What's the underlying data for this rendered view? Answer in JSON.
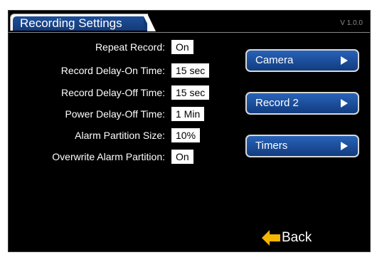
{
  "header": {
    "title": "Recording Settings",
    "version": "V 1.0.0"
  },
  "settings": [
    {
      "label": "Repeat Record:",
      "value": "On"
    },
    {
      "label": "Record Delay-On Time:",
      "value": "15 sec"
    },
    {
      "label": "Record Delay-Off Time:",
      "value": "15 sec"
    },
    {
      "label": "Power Delay-Off Time:",
      "value": "1 Min"
    },
    {
      "label": "Alarm Partition Size:",
      "value": "10%"
    },
    {
      "label": "Overwrite Alarm Partition:",
      "value": "On"
    }
  ],
  "nav": {
    "camera": "Camera",
    "record2": "Record 2",
    "timers": "Timers"
  },
  "back": {
    "label": "Back",
    "arrow_color": "#f5b400"
  },
  "colors": {
    "background": "#000000",
    "button_blue": "#1e4f99",
    "value_bg": "#ffffff"
  }
}
